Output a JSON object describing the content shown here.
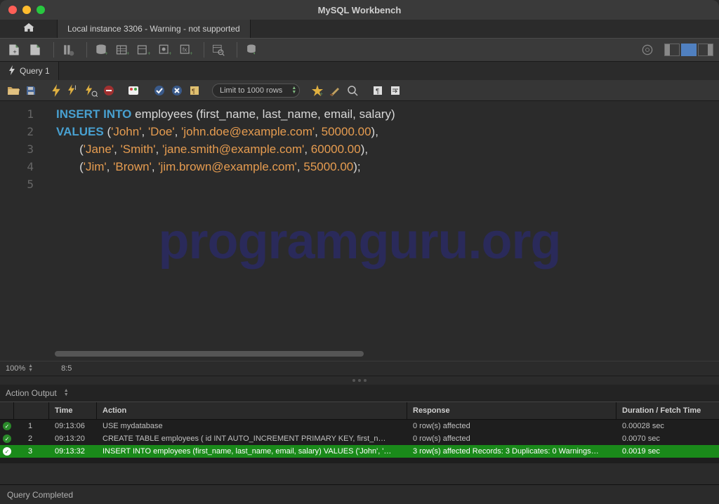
{
  "window": {
    "title": "MySQL Workbench"
  },
  "connection_tab": {
    "label": "Local instance 3306 - Warning - not supported"
  },
  "query_tab": {
    "label": "Query 1"
  },
  "sql_toolbar": {
    "limit": "Limit to 1000 rows"
  },
  "editor": {
    "zoom": "100%",
    "cursor": "8:5",
    "watermark": "programguru.org",
    "lines": [
      1,
      2,
      3,
      4,
      5
    ],
    "sql": {
      "l1_kw1": "INSERT",
      "l1_kw2": "INTO",
      "l1_table": "employees",
      "l1_cols_open": "(",
      "l1_col1": "first_name",
      "l1_c": ",",
      "l1_col2": "last_name",
      "l1_col3": "email",
      "l1_col4": "salary",
      "l1_close": ")",
      "l2_kw": "VALUES",
      "l2_open": "(",
      "l2_s1": "'John'",
      "l2_s2": "'Doe'",
      "l2_s3": "'john.doe@example.com'",
      "l2_n": "50000.00",
      "l2_end": "),",
      "l3_open": "(",
      "l3_s1": "'Jane'",
      "l3_s2": "'Smith'",
      "l3_s3": "'jane.smith@example.com'",
      "l3_n": "60000.00",
      "l3_end": "),",
      "l4_open": "(",
      "l4_s1": "'Jim'",
      "l4_s2": "'Brown'",
      "l4_s3": "'jim.brown@example.com'",
      "l4_n": "55000.00",
      "l4_end": ");"
    }
  },
  "output": {
    "section_label": "Action Output",
    "headers": {
      "time": "Time",
      "action": "Action",
      "response": "Response",
      "duration": "Duration / Fetch Time"
    },
    "rows": [
      {
        "idx": "1",
        "time": "09:13:06",
        "action": "USE mydatabase",
        "response": "0 row(s) affected",
        "duration": "0.00028 sec"
      },
      {
        "idx": "2",
        "time": "09:13:20",
        "action": "CREATE TABLE employees (     id INT AUTO_INCREMENT PRIMARY KEY,     first_n…",
        "response": "0 row(s) affected",
        "duration": "0.0070 sec"
      },
      {
        "idx": "3",
        "time": "09:13:32",
        "action": "INSERT INTO employees (first_name, last_name, email, salary) VALUES ('John', '…",
        "response": "3 row(s) affected Records: 3  Duplicates: 0  Warnings…",
        "duration": "0.0019 sec"
      }
    ]
  },
  "footer": {
    "status": "Query Completed"
  }
}
